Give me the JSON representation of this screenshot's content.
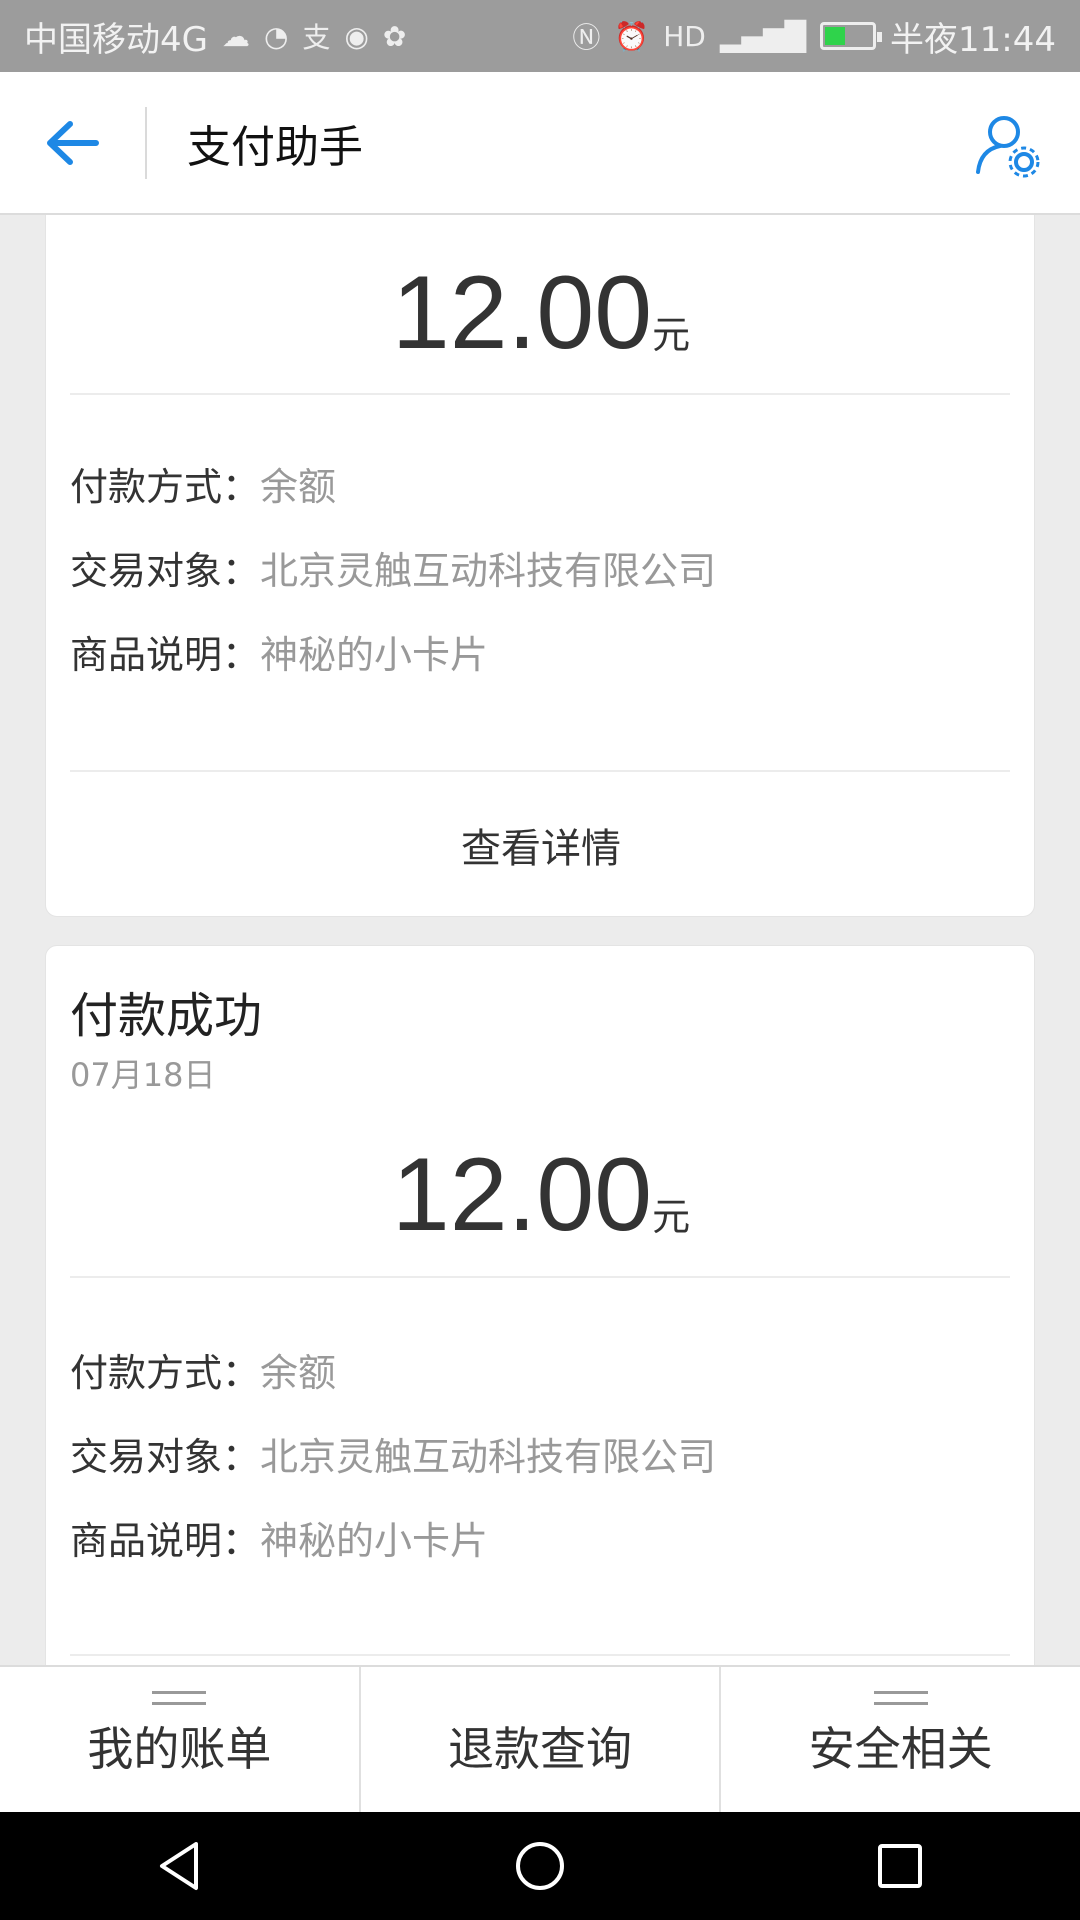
{
  "status_bar": {
    "carrier": "中国移动4G",
    "time_label": "半夜11:44",
    "left_icons": [
      "cloud-icon",
      "wechat-icon",
      "alipay-icon",
      "audio-icon",
      "uc-browser-icon"
    ],
    "right_icons": [
      "nfc-icon",
      "alarm-icon",
      "hd-icon",
      "signal-icon",
      "battery-icon"
    ]
  },
  "header": {
    "title": "支付助手",
    "accent_color": "#1e88e5"
  },
  "cards": [
    {
      "amount": "12.00",
      "unit": "元",
      "rows": [
        {
          "key": "付款方式：",
          "value": "余额"
        },
        {
          "key": "交易对象：",
          "value": "北京灵触互动科技有限公司"
        },
        {
          "key": "商品说明：",
          "value": "神秘的小卡片"
        }
      ],
      "detail_link": "查看详情"
    },
    {
      "title": "付款成功",
      "date": "07月18日",
      "amount": "12.00",
      "unit": "元",
      "rows": [
        {
          "key": "付款方式：",
          "value": "余额"
        },
        {
          "key": "交易对象：",
          "value": "北京灵触互动科技有限公司"
        },
        {
          "key": "商品说明：",
          "value": "神秘的小卡片"
        }
      ]
    }
  ],
  "bottom_nav": {
    "items": [
      {
        "label": "我的账单",
        "has_menu": true
      },
      {
        "label": "退款查询",
        "has_menu": false
      },
      {
        "label": "安全相关",
        "has_menu": true
      }
    ]
  }
}
